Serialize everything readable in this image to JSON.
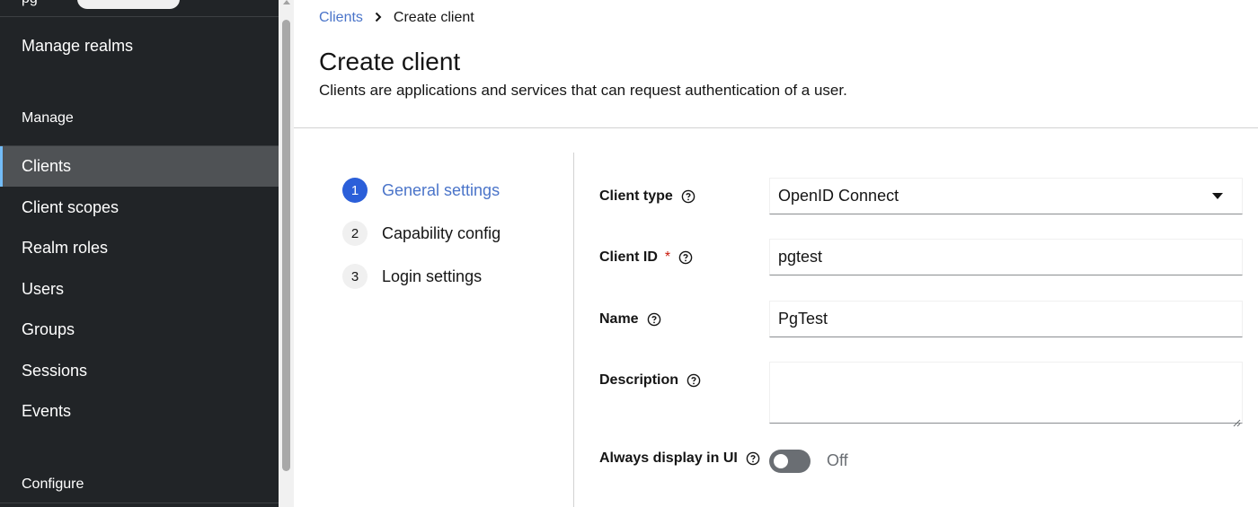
{
  "sidebar": {
    "realm_fragment": "pg",
    "manage_realms": "Manage realms",
    "manage_heading": "Manage",
    "items": [
      {
        "label": "Clients"
      },
      {
        "label": "Client scopes"
      },
      {
        "label": "Realm roles"
      },
      {
        "label": "Users"
      },
      {
        "label": "Groups"
      },
      {
        "label": "Sessions"
      },
      {
        "label": "Events"
      }
    ],
    "configure_heading": "Configure"
  },
  "breadcrumb": {
    "parent": "Clients",
    "current": "Create client"
  },
  "header": {
    "title": "Create client",
    "description": "Clients are applications and services that can request authentication of a user."
  },
  "wizard": {
    "steps": [
      {
        "number": "1",
        "label": "General settings"
      },
      {
        "number": "2",
        "label": "Capability config"
      },
      {
        "number": "3",
        "label": "Login settings"
      }
    ]
  },
  "form": {
    "client_type": {
      "label": "Client type",
      "value": "OpenID Connect"
    },
    "client_id": {
      "label": "Client ID",
      "required_mark": "*",
      "value": "pgtest"
    },
    "name": {
      "label": "Name",
      "value": "PgTest"
    },
    "description": {
      "label": "Description",
      "value": ""
    },
    "always_display": {
      "label": "Always display in UI",
      "state": "Off"
    }
  },
  "colors": {
    "sidebar_bg": "#212427",
    "active_item_bg": "#4f5255",
    "active_item_border": "#73bcf7",
    "link": "#4a74c9",
    "step_active": "#2b5fd9",
    "required": "#c9190b"
  }
}
